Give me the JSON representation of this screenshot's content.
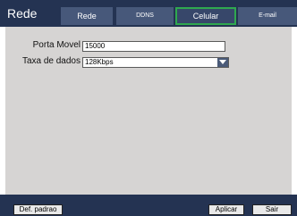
{
  "header": {
    "title": "Rede",
    "tabs": [
      {
        "label": "Rede",
        "active": false
      },
      {
        "label": "DDNS",
        "active": false
      },
      {
        "label": "Celular",
        "active": true
      },
      {
        "label": "E-mail",
        "active": false
      }
    ]
  },
  "form": {
    "port_label": "Porta Movel",
    "port_value": "15000",
    "rate_label": "Taxa de dados",
    "rate_value": "128Kbps"
  },
  "footer": {
    "default_label": "Def. padrao",
    "apply_label": "Aplicar",
    "exit_label": "Sair"
  },
  "colors": {
    "header_bg": "#243352",
    "tab_bg": "#47587a",
    "active_tab_border": "#2fa84f",
    "content_bg": "#d6d4d3"
  }
}
